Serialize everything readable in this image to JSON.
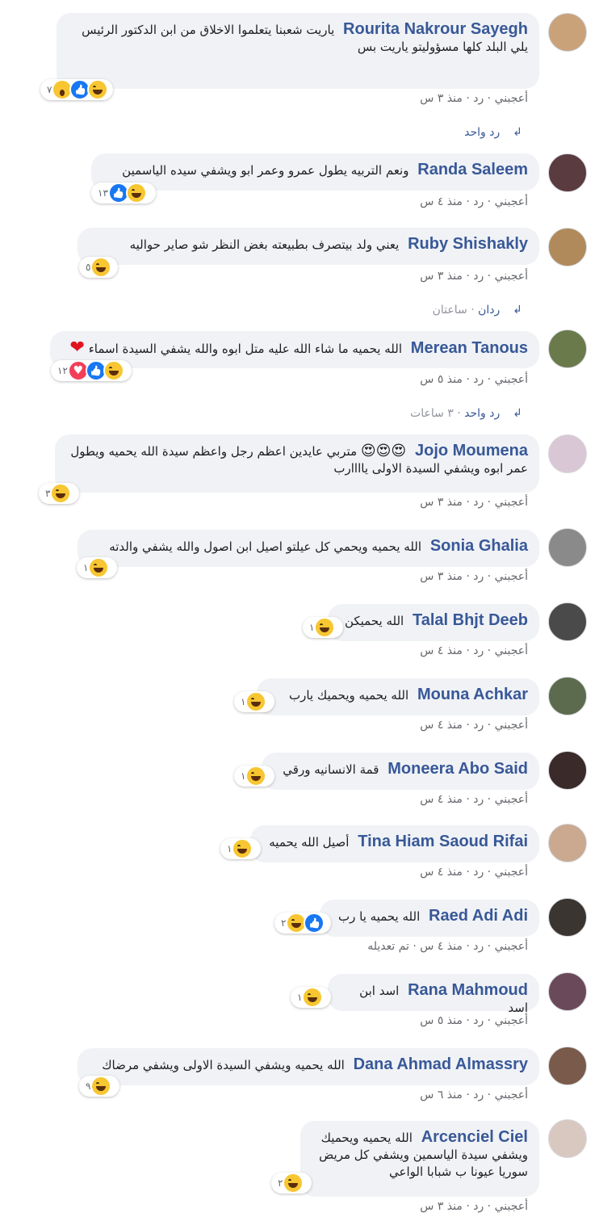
{
  "comments": [
    {
      "name": "Rourita Nakrour Sayegh",
      "text": "ياريت شعبنا يتعلموا الاخلاق من ابن الدكتور الرئيس يلي البلد كلها مسؤوليتو ياريت بس",
      "reaction_count": "٧",
      "meta_like": "أعجبني",
      "meta_reply": "رد",
      "meta_time": "منذ ٣ س",
      "avatar_color": "#c9a27a"
    },
    {
      "name": "Randa Saleem",
      "text": "ونعم التربيه يطول عمرو وعمر ابو ويشفي سيده الياسمين",
      "reaction_count": "١٣",
      "meta_like": "أعجبني",
      "meta_reply": "رد",
      "meta_time": "منذ ٤ س",
      "avatar_color": "#5a3b3f"
    },
    {
      "name": "Ruby Shishakly",
      "text": "يعني ولد بيتصرف بطبيعته بغض النظر شو صاير حواليه",
      "reaction_count": "٥",
      "meta_like": "أعجبني",
      "meta_reply": "رد",
      "meta_time": "منذ ٣ س",
      "avatar_color": "#b08a5a"
    },
    {
      "name": "Merean Tanous",
      "text": "الله يحميه ما شاء الله عليه متل ابوه والله يشفي السيدة اسماء",
      "reaction_count": "١٢",
      "meta_like": "أعجبني",
      "meta_reply": "رد",
      "meta_time": "منذ ٥ س",
      "avatar_color": "#6a7a4a"
    },
    {
      "name": "Jojo Moumena",
      "text": "متربي عايدين اعظم رجل واعظم سيدة الله يحميه ويطول عمر ابوه ويشفي السيدة الاولى ياااارب",
      "reaction_count": "٣",
      "meta_like": "أعجبني",
      "meta_reply": "رد",
      "meta_time": "منذ ٣ س",
      "avatar_color": "#d9c7d6"
    },
    {
      "name": "Sonia Ghalia",
      "text": "الله يحميه ويحمي كل عيلتو اصيل ابن اصول والله يشفي والدته",
      "reaction_count": "١",
      "meta_like": "أعجبني",
      "meta_reply": "رد",
      "meta_time": "منذ ٣ س",
      "avatar_color": "#8a8a8a"
    },
    {
      "name": "Talal Bhjt Deeb",
      "text": "الله يحميكن",
      "reaction_count": "١",
      "meta_like": "أعجبني",
      "meta_reply": "رد",
      "meta_time": "منذ ٤ س",
      "avatar_color": "#4a4a4a"
    },
    {
      "name": "Mouna Achkar",
      "text": "الله يحميه ويحميك يارب",
      "reaction_count": "١",
      "meta_like": "أعجبني",
      "meta_reply": "رد",
      "meta_time": "منذ ٤ س",
      "avatar_color": "#5c6b4e"
    },
    {
      "name": "Moneera Abo Said",
      "text": "قمة الانسانيه ورقي",
      "reaction_count": "١",
      "meta_like": "أعجبني",
      "meta_reply": "رد",
      "meta_time": "منذ ٤ س",
      "avatar_color": "#3a2a2a"
    },
    {
      "name": "Tina Hiam Saoud Rifai",
      "text": "أصيل الله يحميه",
      "reaction_count": "١",
      "meta_like": "أعجبني",
      "meta_reply": "رد",
      "meta_time": "منذ ٤ س",
      "avatar_color": "#caa990"
    },
    {
      "name": "Raed Adi Adi",
      "text": "الله يحميه يا رب",
      "reaction_count": "٢",
      "meta_like": "أعجبني",
      "meta_reply": "رد",
      "meta_time": "منذ ٤ س",
      "meta_edited": "تم تعديله",
      "avatar_color": "#3a3530"
    },
    {
      "name": "Rana Mahmoud",
      "text": "اسد ابن اسد",
      "reaction_count": "١",
      "meta_like": "أعجبني",
      "meta_reply": "رد",
      "meta_time": "منذ ٥ س",
      "avatar_color": "#6a4a5a"
    },
    {
      "name": "Dana Ahmad Almassry",
      "text": "الله يحميه ويشفي السيدة الاولى ويشفي مرضاك",
      "reaction_count": "٩",
      "meta_like": "أعجبني",
      "meta_reply": "رد",
      "meta_time": "منذ ٦ س",
      "avatar_color": "#7a5a4a"
    },
    {
      "name": "Arcenciel Ciel",
      "text": "الله يحميه ويحميك ويشفي سيدة الياسمين ويشفي كل مريض سوريا عيونا ب شبابا الواعي",
      "reaction_count": "٢",
      "meta_like": "أعجبني",
      "meta_reply": "رد",
      "meta_time": "منذ ٣ س",
      "avatar_color": "#d8c8c0"
    }
  ],
  "reply_links": [
    {
      "label": "رد واحد",
      "time": ""
    },
    {
      "label": "ردان",
      "time": "ساعتان"
    },
    {
      "label": "رد واحد",
      "time": "٣ ساعات"
    }
  ],
  "separator": "·",
  "icons": [
    "haha-reaction-icon",
    "wow-reaction-icon",
    "like-reaction-icon",
    "love-reaction-icon",
    "reply-arrow-icon",
    "heart-emoji-icon",
    "heart-eyes-emoji-icon"
  ]
}
